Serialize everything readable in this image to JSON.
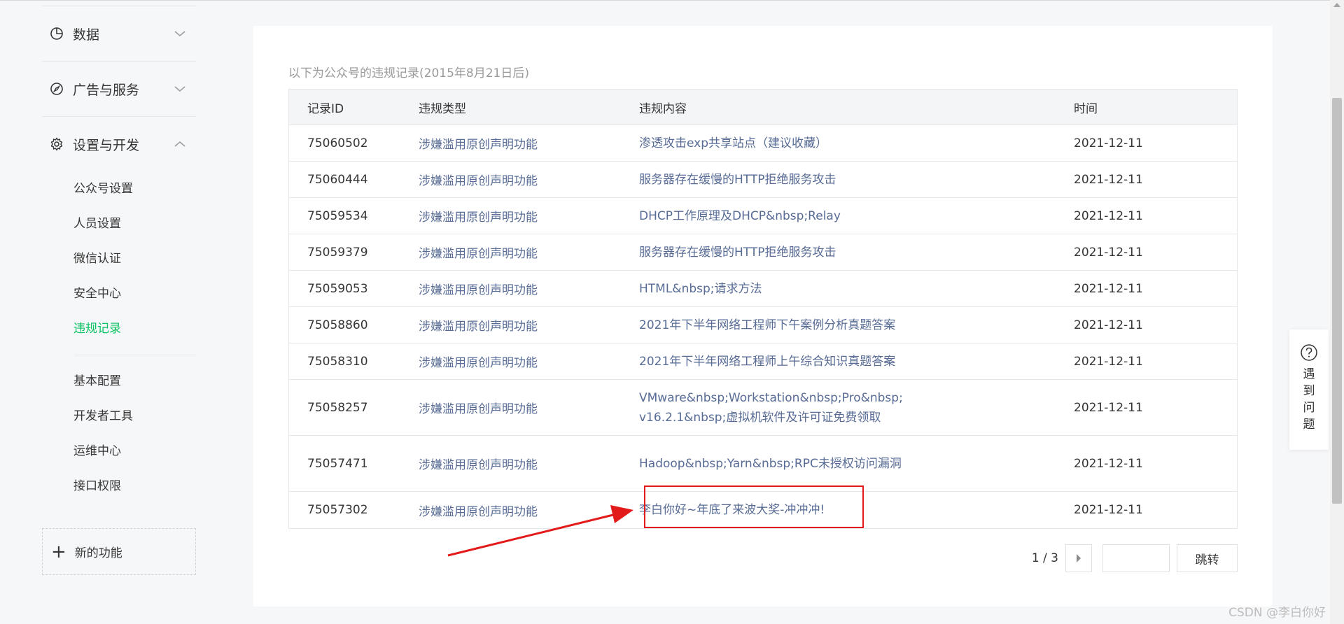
{
  "sidebar": {
    "groups": [
      {
        "label": "数据",
        "icon": "pie-chart-icon",
        "state": "collapsed"
      },
      {
        "label": "广告与服务",
        "icon": "compass-icon",
        "state": "collapsed"
      },
      {
        "label": "设置与开发",
        "icon": "gear-icon",
        "state": "expanded"
      }
    ],
    "settings_items": [
      "公众号设置",
      "人员设置",
      "微信认证",
      "安全中心",
      "违规记录"
    ],
    "dev_items": [
      "基本配置",
      "开发者工具",
      "运维中心",
      "接口权限"
    ],
    "active_item": "违规记录",
    "new_feature_label": "新的功能"
  },
  "main": {
    "notice": "以下为公众号的违规记录(2015年8月21日后)",
    "columns": [
      "记录ID",
      "违规类型",
      "违规内容",
      "时间"
    ],
    "rows": [
      {
        "id": "75060502",
        "type": "涉嫌滥用原创声明功能",
        "content": "渗透攻击exp共享站点（建议收藏）",
        "time": "2021-12-11"
      },
      {
        "id": "75060444",
        "type": "涉嫌滥用原创声明功能",
        "content": "服务器存在缓慢的HTTP拒绝服务攻击",
        "time": "2021-12-11"
      },
      {
        "id": "75059534",
        "type": "涉嫌滥用原创声明功能",
        "content": "DHCP工作原理及DHCP&nbsp;Relay",
        "time": "2021-12-11"
      },
      {
        "id": "75059379",
        "type": "涉嫌滥用原创声明功能",
        "content": "服务器存在缓慢的HTTP拒绝服务攻击",
        "time": "2021-12-11"
      },
      {
        "id": "75059053",
        "type": "涉嫌滥用原创声明功能",
        "content": "HTML&nbsp;请求方法",
        "time": "2021-12-11"
      },
      {
        "id": "75058860",
        "type": "涉嫌滥用原创声明功能",
        "content": "2021年下半年网络工程师下午案例分析真题答案",
        "time": "2021-12-11"
      },
      {
        "id": "75058310",
        "type": "涉嫌滥用原创声明功能",
        "content": "2021年下半年网络工程师上午综合知识真题答案",
        "time": "2021-12-11"
      },
      {
        "id": "75058257",
        "type": "涉嫌滥用原创声明功能",
        "content": "VMware&nbsp;Workstation&nbsp;Pro&nbsp;v16.2.1&nbsp;虚拟机软件及许可证免费领取",
        "time": "2021-12-11"
      },
      {
        "id": "75057471",
        "type": "涉嫌滥用原创声明功能",
        "content": "Hadoop&nbsp;Yarn&nbsp;RPC未授权访问漏洞",
        "time": "2021-12-11"
      },
      {
        "id": "75057302",
        "type": "涉嫌滥用原创声明功能",
        "content": "李白你好~年底了来波大奖-冲冲冲!",
        "time": "2021-12-11"
      }
    ],
    "pagination": {
      "page_text": "1 / 3",
      "jump_label": "跳转"
    }
  },
  "help": {
    "label": "遇到问题"
  },
  "watermark": "CSDN @李白你好",
  "colors": {
    "accent_green": "#07c160",
    "link_blue": "#576b95",
    "annotation_red": "#e31a1a"
  }
}
